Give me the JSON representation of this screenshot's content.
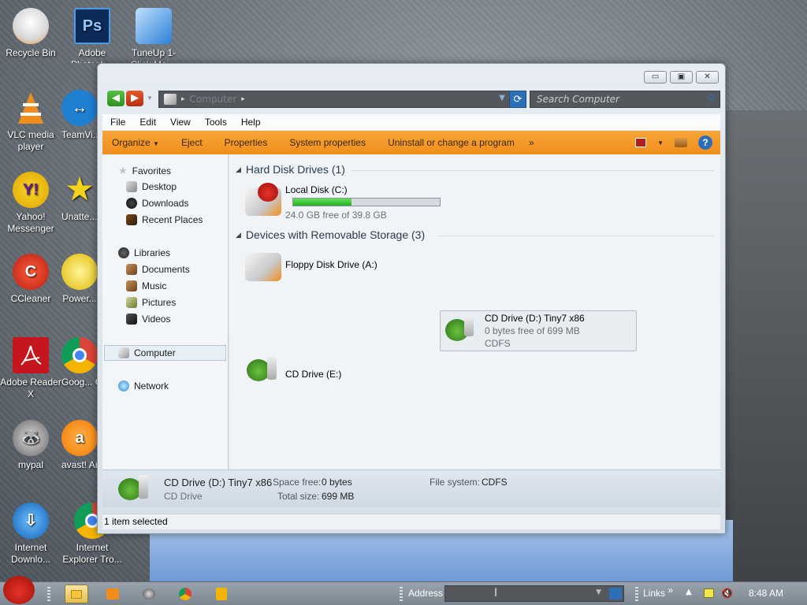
{
  "desktop": {
    "icons": [
      {
        "label": "Recycle Bin",
        "name": "recycle-bin-icon"
      },
      {
        "label": "Adobe Photosh...",
        "name": "photoshop-icon",
        "glyph": "Ps"
      },
      {
        "label": "TuneUp 1-Click Mai...",
        "name": "tuneup-icon"
      },
      {
        "label": "VLC media player",
        "name": "vlc-icon"
      },
      {
        "label": "TeamVi...",
        "name": "teamviewer-icon"
      },
      {
        "label": "Yahoo! Messenger",
        "name": "yahoo-messenger-icon"
      },
      {
        "label": "Unatte... Soft...",
        "name": "unattended-software-icon"
      },
      {
        "label": "CCleaner",
        "name": "ccleaner-icon"
      },
      {
        "label": "Power...",
        "name": "power-icon"
      },
      {
        "label": "Adobe Reader X",
        "name": "adobe-reader-icon"
      },
      {
        "label": "Goog... Chro...",
        "name": "google-chrome-icon"
      },
      {
        "label": "mypal",
        "name": "mypal-icon"
      },
      {
        "label": "avast! Antiv...",
        "name": "avast-icon"
      },
      {
        "label": "Internet Downlo...",
        "name": "internet-download-manager-icon"
      },
      {
        "label": "Internet Explorer Tro...",
        "name": "internet-explorer-trouble-icon"
      }
    ]
  },
  "window": {
    "address": {
      "path": "Computer",
      "separator": "▸"
    },
    "search_placeholder": "Search Computer",
    "menu": [
      "File",
      "Edit",
      "View",
      "Tools",
      "Help"
    ],
    "commands": {
      "organize": "Organize",
      "eject": "Eject",
      "properties": "Properties",
      "system_properties": "System properties",
      "uninstall": "Uninstall or change a program",
      "more": "»"
    },
    "nav": {
      "favorites": "Favorites",
      "desktop": "Desktop",
      "downloads": "Downloads",
      "recent_places": "Recent Places",
      "libraries": "Libraries",
      "documents": "Documents",
      "music": "Music",
      "pictures": "Pictures",
      "videos": "Videos",
      "computer": "Computer",
      "network": "Network"
    },
    "groups": {
      "hard_disks": "Hard Disk Drives (1)",
      "removable": "Devices with Removable Storage (3)"
    },
    "drives": {
      "c": {
        "name": "Local Disk (C:)",
        "free_text": "24.0 GB free of 39.8 GB",
        "used_fraction": 0.4
      },
      "a": {
        "name": "Floppy Disk Drive (A:)"
      },
      "d": {
        "name": "CD Drive (D:) Tiny7 x86",
        "free_text": "0 bytes free of 699 MB",
        "fs": "CDFS"
      },
      "e": {
        "name": "CD Drive (E:)"
      }
    },
    "details": {
      "title": "CD Drive (D:) Tiny7 x86",
      "subtitle": "CD Drive",
      "space_free_label": "Space free:",
      "space_free_value": "0 bytes",
      "total_size_label": "Total size:",
      "total_size_value": "699 MB",
      "fs_label": "File system:",
      "fs_value": "CDFS"
    },
    "status": "1 item selected"
  },
  "taskbar": {
    "address_label": "Address",
    "links_label": "Links",
    "links_more": "»",
    "clock": "8:48 AM"
  },
  "colors": {
    "accent": "#f08d1c",
    "progress": "#26b020",
    "selection": "#e8edf2"
  }
}
